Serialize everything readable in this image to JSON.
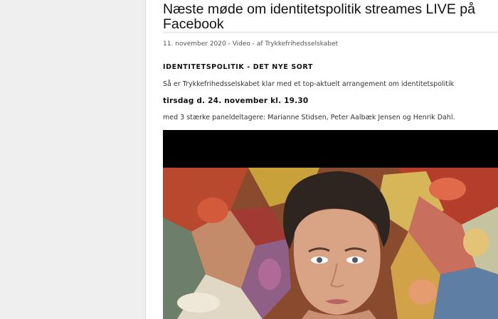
{
  "article": {
    "title": "Næste møde om identitetspolitik streames LIVE på Facebook",
    "meta": "11. november 2020 - Video - af Trykkefrihedsselskabet",
    "section_heading": "IDENTITETSPOLITIK - DET NYE SORT",
    "intro": "Så er Trykkefrihedsselskabet klar med et top-aktuelt arrangement om identitetspolitik",
    "date_line": "tirsdag d. 24. november kl. 19.30",
    "panel_line": "med 3 stærke paneldeltagere: Marianne Stidsen, Peter Aalbæk Jensen og Henrik Dahl."
  },
  "video": {
    "content": "embedded-video-player"
  }
}
